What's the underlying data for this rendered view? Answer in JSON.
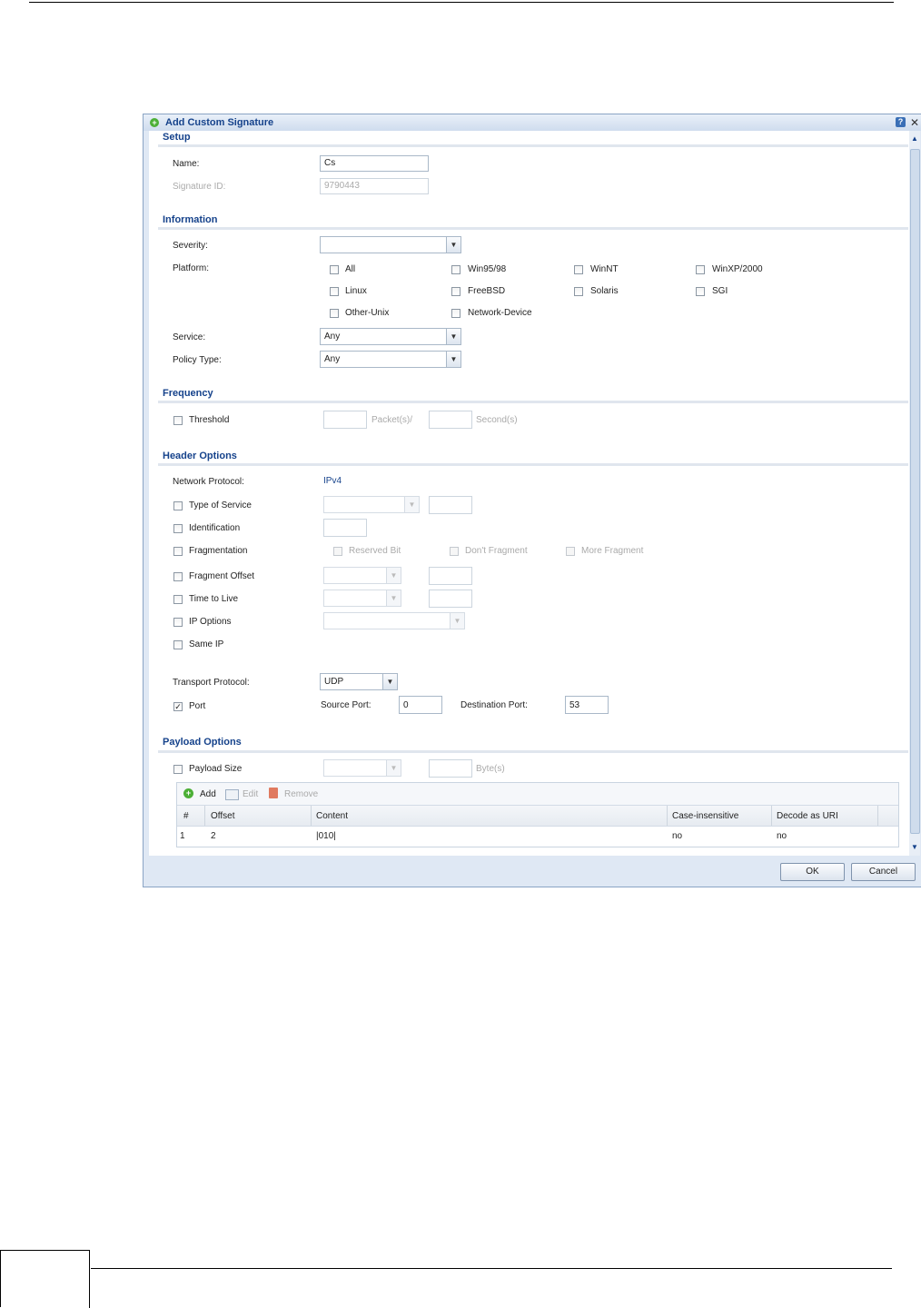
{
  "dialog": {
    "title": "Add Custom Signature"
  },
  "setup": {
    "heading": "Setup",
    "name_label": "Name:",
    "name_value": "Cs",
    "sigid_label": "Signature ID:",
    "sigid_value": "9790443"
  },
  "information": {
    "heading": "Information",
    "severity_label": "Severity:",
    "severity_value": "",
    "platform_label": "Platform:",
    "platforms": [
      "All",
      "Win95/98",
      "WinNT",
      "WinXP/2000",
      "Linux",
      "FreeBSD",
      "Solaris",
      "SGI",
      "Other-Unix",
      "Network-Device"
    ],
    "service_label": "Service:",
    "service_value": "Any",
    "policy_label": "Policy Type:",
    "policy_value": "Any"
  },
  "frequency": {
    "heading": "Frequency",
    "threshold_label": "Threshold",
    "packets_label": "Packet(s)/",
    "seconds_label": "Second(s)"
  },
  "header": {
    "heading": "Header Options",
    "netproto_label": "Network Protocol:",
    "netproto_value": "IPv4",
    "tos_label": "Type of Service",
    "ident_label": "Identification",
    "frag_label": "Fragmentation",
    "reserved_label": "Reserved Bit",
    "dontfrag_label": "Don't Fragment",
    "morefrag_label": "More Fragment",
    "fragoff_label": "Fragment Offset",
    "ttl_label": "Time to Live",
    "ipopt_label": "IP Options",
    "sameip_label": "Same IP",
    "transport_label": "Transport Protocol:",
    "transport_value": "UDP",
    "port_label": "Port",
    "srcport_label": "Source Port:",
    "srcport_value": "0",
    "dstport_label": "Destination Port:",
    "dstport_value": "53"
  },
  "payload": {
    "heading": "Payload Options",
    "size_label": "Payload Size",
    "bytes_label": "Byte(s)",
    "toolbar": {
      "add": "Add",
      "edit": "Edit",
      "remove": "Remove"
    },
    "columns": [
      "#",
      "Offset",
      "Content",
      "Case-insensitive",
      "Decode as URI"
    ],
    "rows": [
      [
        "1",
        "2",
        "|010|",
        "no",
        "no"
      ]
    ]
  },
  "buttons": {
    "ok": "OK",
    "cancel": "Cancel"
  }
}
